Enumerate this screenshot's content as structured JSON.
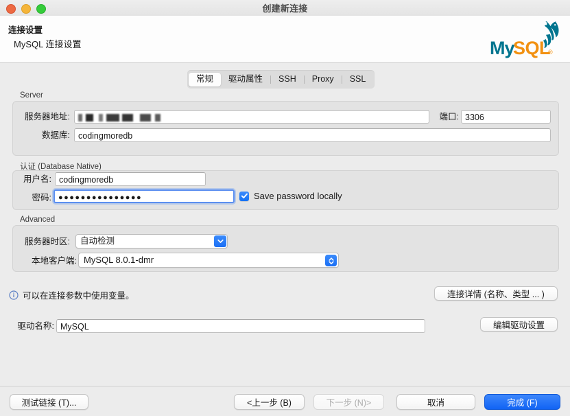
{
  "window": {
    "title": "创建新连接",
    "traffic_lights": [
      "close-button",
      "minimize-button",
      "maximize-button"
    ]
  },
  "header": {
    "title": "连接设置",
    "subtitle": "MySQL 连接设置",
    "logo_my": "My",
    "logo_sql": "SQL",
    "logo_reg": "®"
  },
  "tabs": [
    {
      "label": "常规",
      "active": true
    },
    {
      "label": "驱动属性",
      "active": false
    },
    {
      "label": "SSH",
      "active": false
    },
    {
      "label": "Proxy",
      "active": false
    },
    {
      "label": "SSL",
      "active": false
    }
  ],
  "server_group": {
    "legend": "Server",
    "host_label": "服务器地址:",
    "host_value": "",
    "host_redacted": true,
    "port_label": "端口:",
    "port_value": "3306",
    "database_label": "数据库:",
    "database_value": "codingmoredb"
  },
  "auth_group": {
    "legend": "认证 (Database Native)",
    "username_label": "用户名:",
    "username_value": "codingmoredb",
    "password_label": "密码:",
    "password_value": "●●●●●●●●●●●●●●●",
    "save_password_label": "Save password locally",
    "save_password_checked": true
  },
  "advanced_group": {
    "legend": "Advanced",
    "timezone_label": "服务器时区:",
    "timezone_value": "自动检测",
    "client_label": "本地客户端:",
    "client_value": "MySQL 8.0.1-dmr"
  },
  "info": {
    "icon": "info-circle-icon",
    "text": "可以在连接参数中使用变量。",
    "details_button": "连接详情 (名称、类型 ... )"
  },
  "driver": {
    "name_label": "驱动名称:",
    "name_value": "MySQL",
    "edit_button": "编辑驱动设置"
  },
  "footer": {
    "test_button": "测试链接 (T)...",
    "back_button": "<上一步 (B)",
    "next_button": "下一步 (N)>",
    "next_disabled": true,
    "cancel_button": "取消",
    "finish_button": "完成 (F)"
  },
  "colors": {
    "accent_blue": "#1a6ff5",
    "primary_button": "#1163f4",
    "mysql_teal": "#00758f",
    "mysql_orange": "#f29111",
    "window_bg": "#ececec",
    "group_bg": "#e3e3e3"
  }
}
